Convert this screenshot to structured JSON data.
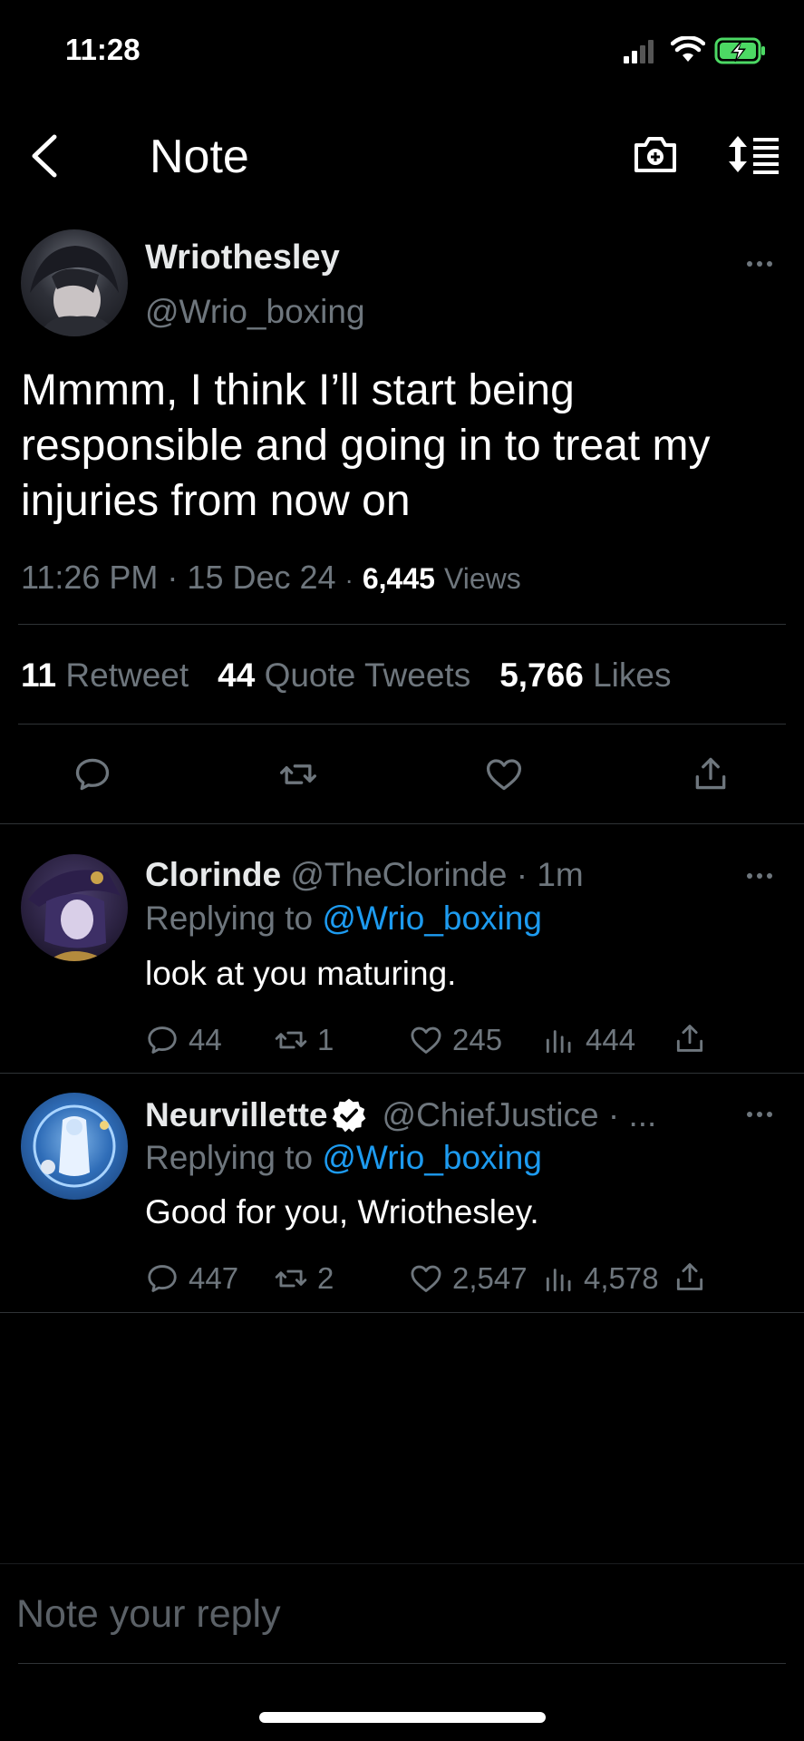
{
  "status_bar": {
    "time": "11:28"
  },
  "header": {
    "title": "Note"
  },
  "tweet": {
    "author_name": "Wriothesley",
    "author_handle": "@Wrio_boxing",
    "text_line1": "Mmmm, I think I’ll start being",
    "text_line2": "responsible and going in to treat my",
    "text_line3": "injuries from now on",
    "time": "11:26 PM",
    "sep": "·",
    "date": "15 Dec 24",
    "views_count": "6,445",
    "views_label": "Views",
    "retweets_count": "11",
    "retweets_label": "Retweet",
    "quotes_count": "44",
    "quotes_label": "Quote Tweets",
    "likes_count": "5,766",
    "likes_label": "Likes"
  },
  "replies": [
    {
      "name": "Clorinde",
      "handle": "@TheClorinde · 1m",
      "replying_prefix": "Replying to",
      "replying_handle": "@Wrio_boxing",
      "text": "look at you maturing.",
      "replies": "44",
      "retweets": "1",
      "likes": "245",
      "views": "444"
    },
    {
      "name": "Neurvillette",
      "handle": "@ChiefJustice · ...",
      "replying_prefix": "Replying to",
      "replying_handle": "@Wrio_boxing",
      "text": "Good for you, Wriothesley.",
      "replies": "447",
      "retweets": "2",
      "likes": "2,547",
      "views": "4,578"
    }
  ],
  "reply_box": {
    "placeholder": "Note your reply"
  },
  "colors": {
    "accent": "#1d9bf0",
    "background": "#000000",
    "muted": "#6e767d",
    "divider": "#2f3336",
    "battery": "#4cd964"
  }
}
